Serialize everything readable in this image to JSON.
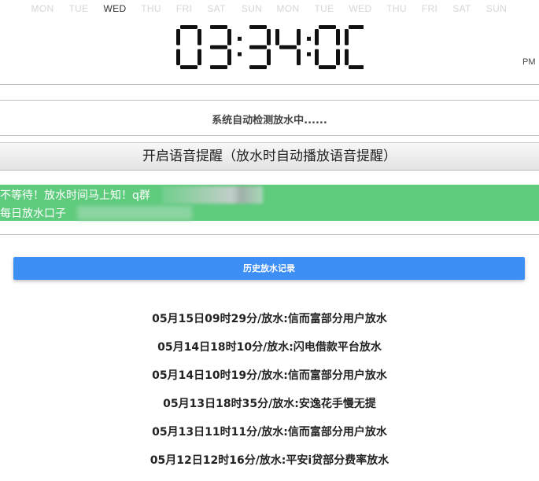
{
  "weekdays": [
    {
      "label": "MON",
      "active": false
    },
    {
      "label": "TUE",
      "active": false
    },
    {
      "label": "WED",
      "active": true
    },
    {
      "label": "THU",
      "active": false
    },
    {
      "label": "FRI",
      "active": false
    },
    {
      "label": "SAT",
      "active": false
    },
    {
      "label": "SUN",
      "active": false
    },
    {
      "label": "MON",
      "active": false
    },
    {
      "label": "TUE",
      "active": false
    },
    {
      "label": "WED",
      "active": false
    },
    {
      "label": "THU",
      "active": false
    },
    {
      "label": "FRI",
      "active": false
    },
    {
      "label": "SAT",
      "active": false
    },
    {
      "label": "SUN",
      "active": false
    }
  ],
  "clock": {
    "time": "03:34:00",
    "period": "PM"
  },
  "status_text": "系统自动检测放水中......",
  "voice_button_label": "开启语音提醒（放水时自动播放语音提醒）",
  "notice": {
    "line1": "不等待！放水时间马上知！q群",
    "line2": "每日放水口子"
  },
  "history_button_label": "历史放水记录",
  "records": [
    "05月15日09时29分/放水:信而富部分用户放水",
    "05月14日18时10分/放水:闪电借款平台放水",
    "05月14日10时19分/放水:信而富部分用户放水",
    "05月13日18时35分/放水:安逸花手慢无提",
    "05月13日11时11分/放水:信而富部分用户放水",
    "05月12日12时16分/放水:平安i贷部分费率放水"
  ],
  "colors": {
    "notice_bg": "#5fcb7d",
    "history_button_bg": "#3d8ef5",
    "inactive_day": "#d6d6d6"
  }
}
